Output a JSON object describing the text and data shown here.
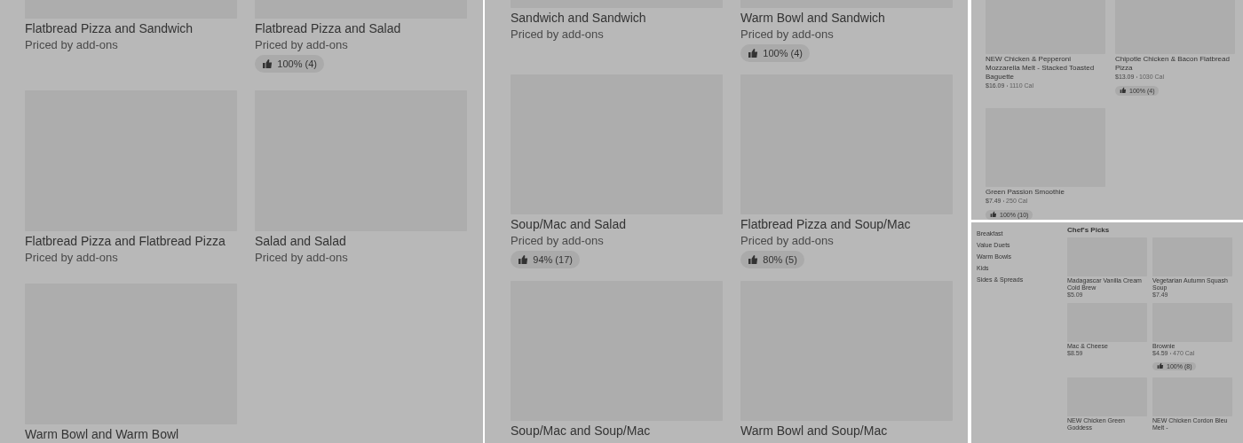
{
  "panels": [
    {
      "cards": [
        {
          "title": "Flatbread Pizza and Sandwich",
          "subtitle": "Priced by add-ons"
        },
        {
          "title": "Flatbread Pizza and Salad",
          "subtitle": "Priced by add-ons",
          "rating": "100% (4)"
        },
        {
          "title": "Flatbread Pizza and Flatbread Pizza",
          "subtitle": "Priced by add-ons"
        },
        {
          "title": "Salad and Salad",
          "subtitle": "Priced by add-ons"
        },
        {
          "title": "Warm Bowl and Warm Bowl"
        }
      ]
    },
    {
      "cards": [
        {
          "title": "Sandwich and Sandwich",
          "subtitle": "Priced by add-ons"
        },
        {
          "title": "Warm Bowl and Sandwich",
          "subtitle": "Priced by add-ons",
          "rating": "100% (4)"
        },
        {
          "title": "Soup/Mac and Salad",
          "subtitle": "Priced by add-ons",
          "rating": "94% (17)"
        },
        {
          "title": "Flatbread Pizza and Soup/Mac",
          "subtitle": "Priced by add-ons",
          "rating": "80% (5)"
        },
        {
          "title": "Soup/Mac and Soup/Mac"
        },
        {
          "title": "Warm Bowl and Soup/Mac"
        }
      ]
    },
    {
      "cards": [
        {
          "title": "NEW Chicken & Pepperoni Mozzarella Melt - Stacked Toasted Baguette",
          "price": "$16.09",
          "calories": "1110 Cal"
        },
        {
          "title": "Chipotle Chicken & Bacon Flatbread Pizza",
          "price": "$13.09",
          "calories": "1030 Cal",
          "rating": "100% (4)"
        },
        {
          "title": "Green Passion Smoothie",
          "price": "$7.49",
          "calories": "250 Cal",
          "rating": "100% (10)"
        }
      ]
    },
    {
      "sidebar": {
        "items": [
          {
            "label": "Breakfast"
          },
          {
            "label": "Value Duets"
          },
          {
            "label": "Warm Bowls"
          },
          {
            "label": "Kids"
          },
          {
            "label": "Sides & Spreads"
          }
        ]
      },
      "section_title": "Chef's Picks",
      "cards": [
        {
          "title": "Madagascar Vanilla Cream Cold Brew",
          "price": "$5.09"
        },
        {
          "title": "Vegetarian Autumn Squash Soup",
          "price": "$7.49"
        },
        {
          "title": "Mac & Cheese",
          "price": "$8.59"
        },
        {
          "title": "Brownie",
          "price": "$4.59",
          "calories": "470 Cal",
          "rating": "100% (8)"
        },
        {
          "title": "NEW Chicken Green Goddess"
        },
        {
          "title": "NEW Chicken Cordon Bleu Melt -"
        }
      ]
    }
  ]
}
